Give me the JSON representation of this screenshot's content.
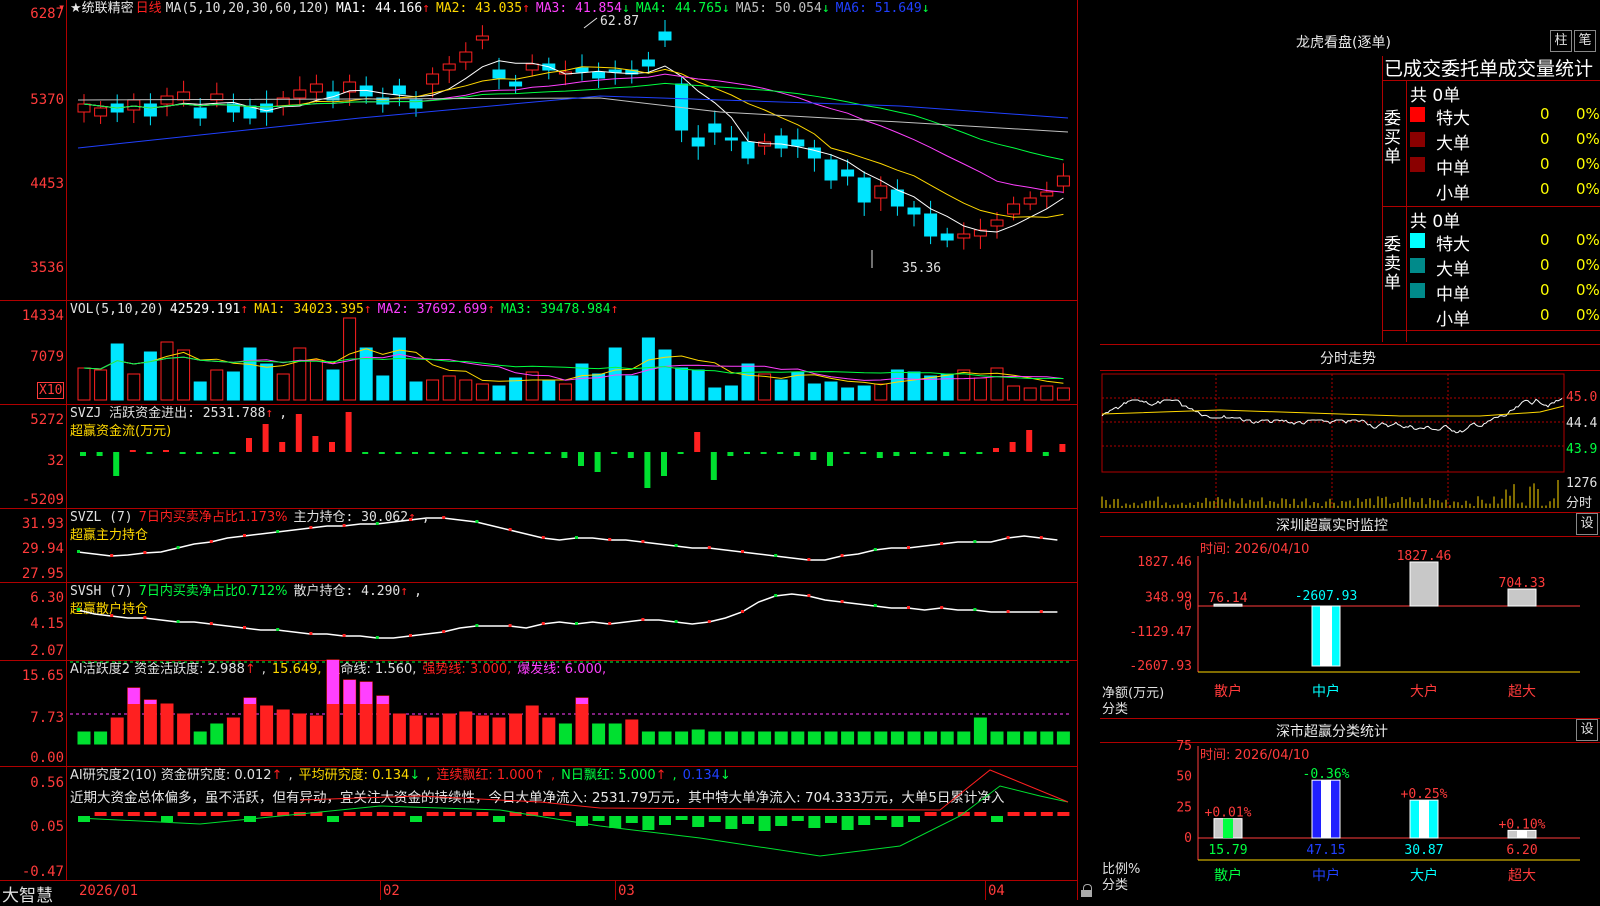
{
  "top_corner_label": "6287",
  "ticker_bar": {
    "arrow": "▾",
    "star_name": "★统联精密",
    "period": "日线",
    "ma_spec": "MA(5,10,20,30,60,120)",
    "ma1": "MA1: 44.166",
    "ma2": "MA2: 43.035",
    "ma3": "MA3: 41.854",
    "ma4": "MA4: 44.765",
    "ma5": "MA5: 50.054",
    "ma6": "MA6: 51.649"
  },
  "colors": {
    "up": "#ff2020",
    "down": "#00e5ff",
    "ma1": "#ffffff",
    "ma2": "#ffd800",
    "ma3": "#ff40ff",
    "ma4": "#00ff40",
    "ma5": "#c0c0c0",
    "ma6": "#2040ff",
    "grid": "#b00000"
  },
  "price_panel": {
    "ylabels": [
      "6287",
      "5370",
      "4453",
      "3536"
    ],
    "high_label": "62.87",
    "low_label": "35.36"
  },
  "vol_panel": {
    "header_name": "VOL(5,10,20)",
    "header_value": "42529.191",
    "ma1": "MA1: 34023.395",
    "ma2": "MA2: 37692.699",
    "ma3": "MA3: 39478.984",
    "ylabels": [
      "14334",
      "7079"
    ],
    "unit": "X10"
  },
  "svzj_panel": {
    "header": "SVZJ  活跃资金进出: 2531.788",
    "sub": "超赢资金流(万元)",
    "ylabels": [
      "5272",
      "32",
      "-5209"
    ]
  },
  "svzl_panel": {
    "header_name": "SVZL (7)",
    "header_pct": "7日内买卖净占比1.173%",
    "header_value": "主力持仓: 30.062",
    "sub": "超赢主力持仓",
    "ylabels": [
      "31.93",
      "29.94",
      "27.95"
    ]
  },
  "svsh_panel": {
    "header_name": "SVSH (7)",
    "header_pct": "7日内买卖净占比0.712%",
    "header_value": "散户持仓: 4.290",
    "sub": "超赢散户持仓",
    "ylabels": [
      "6.30",
      "4.15",
      "2.07"
    ]
  },
  "ai_active_panel": {
    "h1": "AI活跃度2 资金活跃度: 2.988",
    "h2": "15.649",
    "h3": "生命线: 1.560",
    "h4": "强势线: 3.000",
    "h5": "爆发线: 6.000",
    "ylabels": [
      "15.65",
      "7.73",
      "0.00"
    ]
  },
  "ai_research_panel": {
    "h1": "AI研究度2(10) 资金研究度: 0.012",
    "h2": "平均研究度: 0.134",
    "h3": "连续飘红: 1.000",
    "h4": "N日飘红: 5.000",
    "h5": "0.134",
    "comment": "近期大资金总体偏多，虽不活跃，但有异动，宜关注大资金的持续性，今日大单净流入: 2531.79万元，其中特大单净流入: 704.333万元，大单5日累计净入",
    "ylabels": [
      "0.56",
      "0.05",
      "-0.47"
    ]
  },
  "bottom_bar": {
    "brand": "大智慧",
    "dates": [
      "2026/01",
      "02",
      "03",
      "04"
    ]
  },
  "dragon_tiger": {
    "title": "龙虎看盘(逐单)",
    "btn_zhu": "柱",
    "btn_bi": "笔",
    "heading": "已成交委托单成交量统计",
    "buy_label": "委买单",
    "sell_label": "委卖单",
    "buy_total": "共 0单",
    "sell_total": "共 0单",
    "buy_rows": [
      {
        "name": "特大",
        "count": "0",
        "pct": "0%",
        "color": "#ff0000"
      },
      {
        "name": "大单",
        "count": "0",
        "pct": "0%",
        "color": "#8a0000"
      },
      {
        "name": "中单",
        "count": "0",
        "pct": "0%",
        "color": "#8a0000"
      },
      {
        "name": "小单",
        "count": "0",
        "pct": "0%",
        "color": ""
      }
    ],
    "sell_rows": [
      {
        "name": "特大",
        "count": "0",
        "pct": "0%",
        "color": "#00ffff"
      },
      {
        "name": "大单",
        "count": "0",
        "pct": "0%",
        "color": "#008a8a"
      },
      {
        "name": "中单",
        "count": "0",
        "pct": "0%",
        "color": "#008a8a"
      },
      {
        "name": "小单",
        "count": "0",
        "pct": "0%",
        "color": ""
      }
    ]
  },
  "intraday": {
    "title": "分时走势",
    "ylabels": [
      "45.0",
      "44.4",
      "43.9"
    ],
    "vol_label": "1276",
    "vol_unit": "分时"
  },
  "sz_monitor": {
    "title": "深圳超赢实时监控",
    "btn": "设",
    "time": "时间: 2026/04/10",
    "ylabels": [
      "1827.46",
      "348.99",
      "0",
      "-1129.47",
      "-2607.93"
    ],
    "ylabel": "净额(万元)",
    "xlabel": "分类",
    "categories": [
      "散户",
      "中户",
      "大户",
      "超大"
    ],
    "values": [
      76.14,
      -2607.93,
      1827.46,
      704.33
    ],
    "value_labels": [
      "76.14",
      "-2607.93",
      "1827.46",
      "704.33"
    ]
  },
  "sz_class": {
    "title": "深市超赢分类统计",
    "btn": "设",
    "time": "时间: 2026/04/10",
    "ylabels": [
      "75",
      "50",
      "25",
      "0"
    ],
    "ylabel": "比例%",
    "xlabel": "分类",
    "categories": [
      "散户",
      "中户",
      "大户",
      "超大"
    ],
    "values": [
      15.79,
      47.15,
      30.87,
      6.2
    ],
    "value_labels": [
      "15.79",
      "47.15",
      "30.87",
      "6.20"
    ],
    "change_labels": [
      "+0.01%",
      "-0.36%",
      "+0.25%",
      "+0.10%"
    ]
  }
}
